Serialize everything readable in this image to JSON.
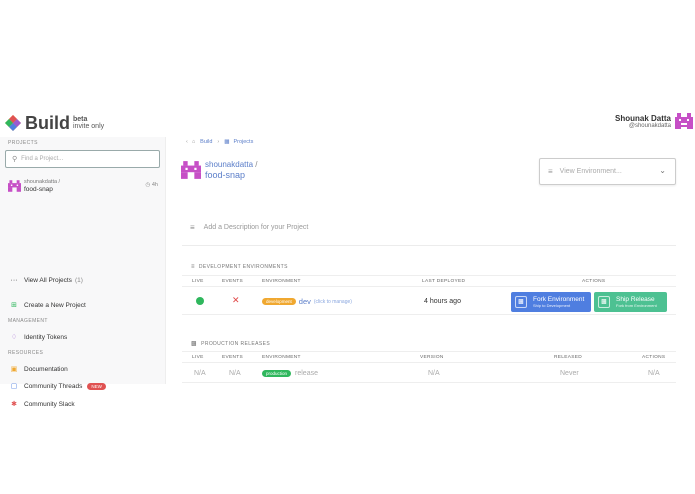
{
  "brand": {
    "name": "Build",
    "tag_top": "beta",
    "tag_bottom": "invite only"
  },
  "user": {
    "name": "Shounak Datta",
    "handle": "@shounakdatta"
  },
  "sidebar": {
    "projects_label": "PROJECTS",
    "search_placeholder": "Find a Project...",
    "project": {
      "owner": "shounakdatta /",
      "name": "food-snap",
      "age": "4h"
    },
    "view_all_label": "View All Projects",
    "view_all_count": "(1)",
    "create_label": "Create a New Project",
    "management_label": "MANAGEMENT",
    "identity_tokens_label": "Identity Tokens",
    "resources_label": "RESOURCES",
    "documentation_label": "Documentation",
    "community_threads_label": "Community Threads",
    "new_badge": "NEW",
    "community_slack_label": "Community Slack"
  },
  "breadcrumbs": {
    "build": "Build",
    "projects": "Projects"
  },
  "project_header": {
    "owner": "shounakdatta",
    "slash": "/",
    "name": "food-snap"
  },
  "env_selector": {
    "placeholder": "View Environment..."
  },
  "description_placeholder": "Add a Description for your Project",
  "dev_section": {
    "title": "DEVELOPMENT ENVIRONMENTS",
    "columns": {
      "live": "LIVE",
      "events": "EVENTS",
      "environment": "ENVIRONMENT",
      "last_deployed": "LAST DEPLOYED",
      "actions": "ACTIONS"
    },
    "row": {
      "badge": "development",
      "env": "dev",
      "manage": "(click to manage)",
      "last_deployed": "4 hours ago",
      "fork_title": "Fork Environment",
      "fork_sub": "Ship to Development",
      "ship_title": "Ship Release",
      "ship_sub": "Fork from Environment"
    }
  },
  "prod_section": {
    "title": "PRODUCTION RELEASES",
    "columns": {
      "live": "LIVE",
      "events": "EVENTS",
      "environment": "ENVIRONMENT",
      "version": "VERSION",
      "released": "RELEASED",
      "actions": "ACTIONS"
    },
    "row": {
      "live": "N/A",
      "events": "N/A",
      "badge": "production",
      "env": "release",
      "version": "N/A",
      "released": "Never",
      "actions": "N/A"
    }
  },
  "colors": {
    "accent": "#5b7ec9",
    "live": "#2fb75d",
    "fork": "#4f7ee0",
    "ship": "#4dc192",
    "dev_badge": "#f0a830"
  },
  "icons": [
    "build-logo-icon",
    "avatar-icon",
    "search-icon",
    "project-avatar-icon",
    "ellipsis-icon",
    "add-project-icon",
    "tag-icon",
    "book-icon",
    "chat-icon",
    "slack-icon",
    "home-icon",
    "box-icon",
    "layers-icon",
    "chevron-down-icon",
    "lines-icon",
    "x-icon"
  ]
}
